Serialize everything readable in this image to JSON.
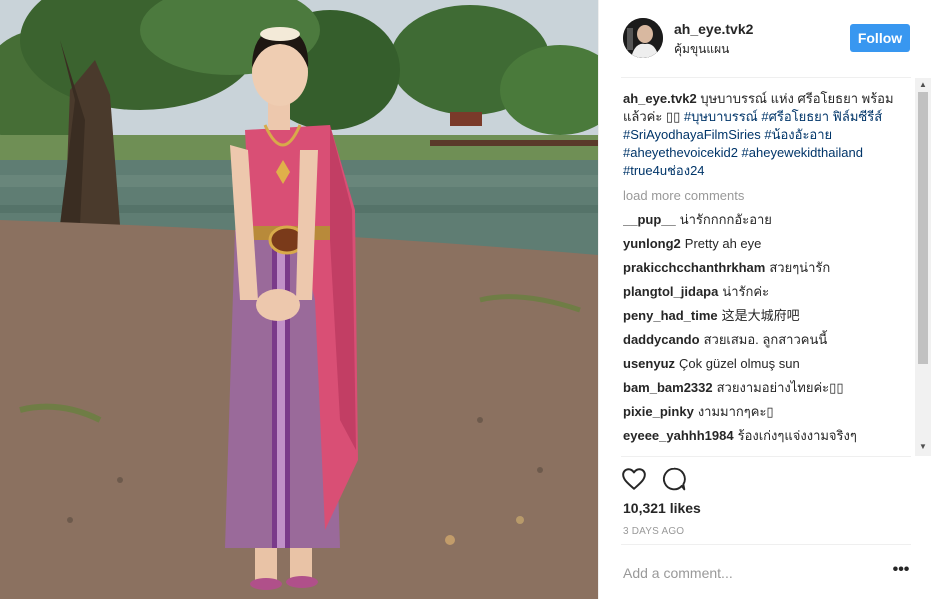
{
  "post": {
    "photo_alt": "Girl in traditional Thai dress standing beside a pond with trees",
    "username": "ah_eye.tvk2",
    "location": "คุ้มขุนแผน",
    "follow_label": "Follow",
    "caption": {
      "user": "ah_eye.tvk2",
      "text": " บุษบาบรรณ์ แห่ง ศรีอโยธยา พร้อมแล้วค่ะ ▯▯ ",
      "tags": "#บุษบาบรรณ์ #ศรีอโยธยา ฟิล์มซีรีส์ #SriAyodhayaFilmSiries #น้องอัะอาย #aheyethevoicekid2 #aheyewekidthailand #true4uช่อง24"
    },
    "load_more": "load more comments",
    "comments": [
      {
        "user": "__pup__",
        "text": "น่ารักกกกอัะอาย"
      },
      {
        "user": "yunlong2",
        "text": "Pretty ah eye"
      },
      {
        "user": "prakicchcchanthrkham",
        "text": "สวยๆน่ารัก"
      },
      {
        "user": "plangtol_jidapa",
        "text": "น่ารักค่ะ"
      },
      {
        "user": "peny_had_time",
        "text": "这是大城府吧"
      },
      {
        "user": "daddycando",
        "text": "สวยเสมอ. ลูกสาวคนนี้"
      },
      {
        "user": "usenyuz",
        "text": "Çok güzel olmuş sun"
      },
      {
        "user": "bam_bam2332",
        "text": "สวยงามอย่างไทยค่ะ▯▯"
      },
      {
        "user": "pixie_pinky",
        "text": "งามมากๆคะ▯"
      },
      {
        "user": "eyeee_yahhh1984",
        "text": "ร้องเก่งๆแจ่งงามจริงๆ"
      }
    ],
    "likes": "10,321 likes",
    "timestamp": "3 DAYS AGO",
    "comment_placeholder": "Add a comment...",
    "more_options": "•••",
    "icons": {
      "like": "heart-icon",
      "comment": "comment-bubble-icon",
      "more": "more-options-icon",
      "scroll_up": "scroll-up-arrow-icon",
      "scroll_down": "scroll-down-arrow-icon"
    },
    "colors": {
      "follow_button": "#3897f0",
      "hashtag": "#003569",
      "muted_text": "#999999",
      "divider": "#efefef"
    }
  }
}
